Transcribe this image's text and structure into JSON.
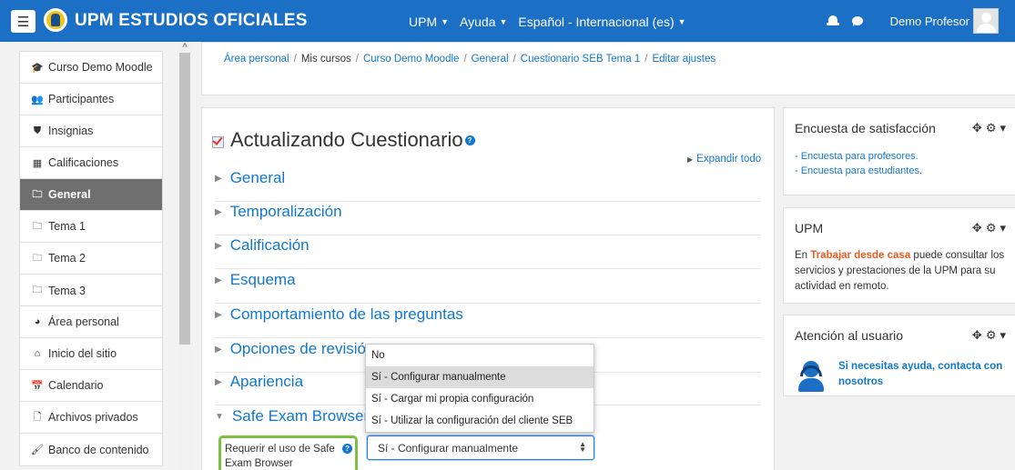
{
  "navbar": {
    "site_title": "UPM ESTUDIOS OFICIALES",
    "menu": [
      "UPM",
      "Ayuda",
      "Español - Internacional (es)"
    ],
    "user_name": "Demo Profesor",
    "brand_color": "#1b6fc4"
  },
  "drawer": {
    "course_items": [
      {
        "label": "Curso Demo Moodle",
        "icon": "graduation-cap-icon"
      },
      {
        "label": "Participantes",
        "icon": "users-icon"
      },
      {
        "label": "Insignias",
        "icon": "shield-icon"
      },
      {
        "label": "Calificaciones",
        "icon": "table-icon"
      },
      {
        "label": "General",
        "icon": "folder-icon",
        "active": true
      },
      {
        "label": "Tema 1",
        "icon": "folder-icon"
      },
      {
        "label": "Tema 2",
        "icon": "folder-icon"
      },
      {
        "label": "Tema 3",
        "icon": "folder-icon"
      }
    ],
    "site_items": [
      {
        "label": "Área personal",
        "icon": "dashboard-icon"
      },
      {
        "label": "Inicio del sitio",
        "icon": "home-icon"
      },
      {
        "label": "Calendario",
        "icon": "calendar-icon"
      },
      {
        "label": "Archivos privados",
        "icon": "file-icon"
      },
      {
        "label": "Banco de contenido",
        "icon": "paint-brush-icon"
      }
    ]
  },
  "breadcrumb": {
    "items": [
      "Área personal",
      "Mis cursos",
      "Curso Demo Moodle",
      "General",
      "Cuestionario SEB Tema 1",
      "Editar ajustes"
    ]
  },
  "main": {
    "heading": "Actualizando Cuestionario",
    "expand_all": "Expandir todo",
    "sections": [
      "General",
      "Temporalización",
      "Calificación",
      "Esquema",
      "Comportamiento de las preguntas",
      "Opciones de revisión",
      "Apariencia",
      "Safe Exam Browser"
    ],
    "field_label": "Requerir el uso de Safe Exam Browser",
    "select_value": "Sí - Configurar manualmente",
    "dropdown_options": [
      "No",
      "Sí - Configurar manualmente",
      "Sí - Cargar mi propia configuración",
      "Sí - Utilizar la configuración del cliente SEB"
    ],
    "dropdown_selected_index": 1
  },
  "blocks": {
    "survey": {
      "title": "Encuesta de satisfacción",
      "links": [
        "- Encuesta para profesores.",
        "- Encuesta para estudiantes."
      ]
    },
    "upm": {
      "title": "UPM",
      "text_before": "En ",
      "highlight": "Trabajar desde casa",
      "text_after": " puede consultar los servicios y prestaciones de la UPM para su actividad en remoto.",
      "highlight_color": "#f05a22"
    },
    "support": {
      "title": "Atención al usuario",
      "link": "Si necesitas ayuda, contacta con nosotros"
    }
  }
}
